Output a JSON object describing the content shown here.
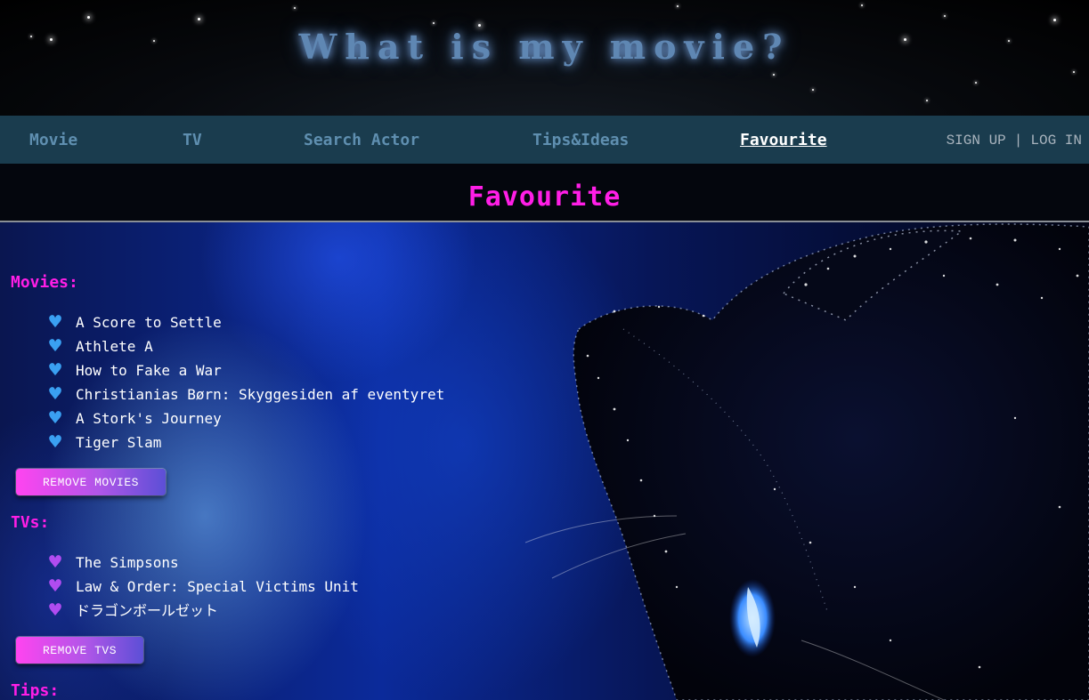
{
  "header": {
    "site_title": "What is my movie?"
  },
  "nav": {
    "items": [
      {
        "label": "Movie"
      },
      {
        "label": "TV"
      },
      {
        "label": "Search Actor"
      },
      {
        "label": "Tips&Ideas"
      },
      {
        "label": "Favourite",
        "active": true
      }
    ],
    "sign_up": "SIGN UP",
    "separator": "|",
    "log_in": "LOG IN"
  },
  "page": {
    "title": "Favourite"
  },
  "movies": {
    "heading": "Movies:",
    "heart_icon": "blue-heart-icon",
    "items": [
      "A Score to Settle",
      "Athlete A",
      "How to Fake a War",
      "Christianias Børn: Skyggesiden af eventyret",
      "A Stork's Journey",
      "Tiger Slam"
    ],
    "remove_label": "REMOVE MOVIES"
  },
  "tvs": {
    "heading": "TVs:",
    "heart_icon": "purple-heart-icon",
    "items": [
      "The Simpsons",
      "Law & Order: Special Victims Unit",
      "ドラゴンボールゼット"
    ],
    "remove_label": "REMOVE TVS"
  },
  "tips": {
    "heading": "Tips:"
  },
  "colors": {
    "accent_magenta": "#ff1ee6",
    "nav_bg": "#1a3c4e",
    "nav_text": "#5f8fb0",
    "title_glow": "#5f87b3",
    "heart_blue": "#3aa0f2",
    "heart_purple": "#b04cf0"
  }
}
